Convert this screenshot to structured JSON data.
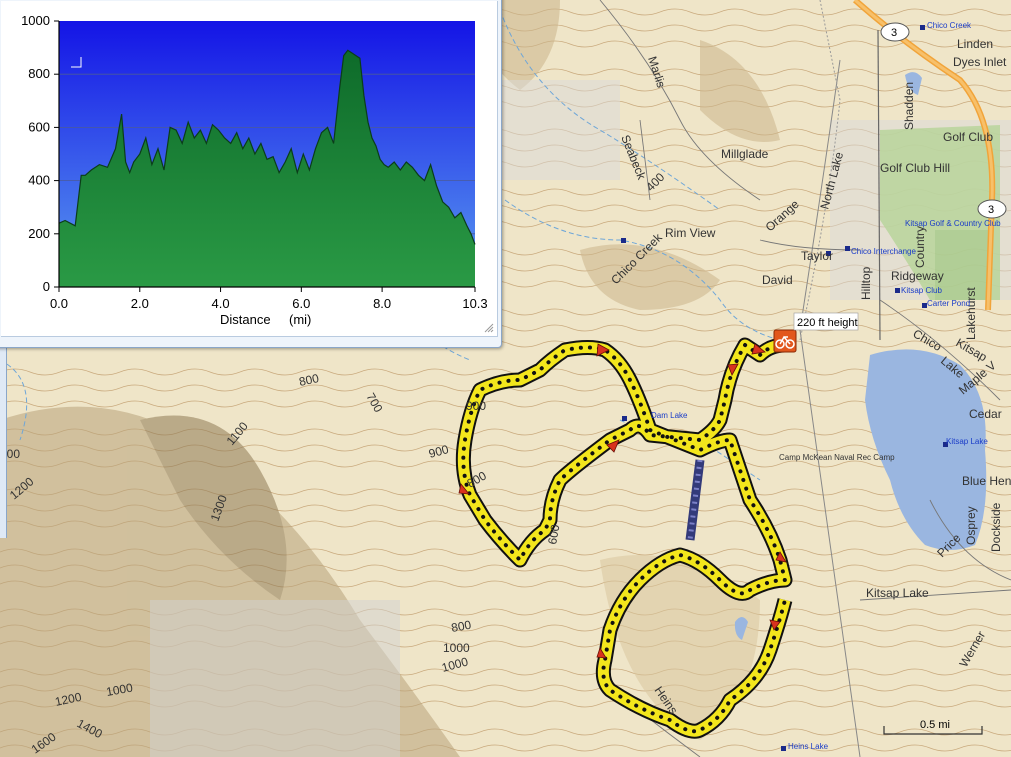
{
  "map": {
    "height_label": "220 ft height",
    "scale_label": "0.5 mi",
    "roads": [
      "Marlis",
      "Seabeck",
      "Millglade",
      "North Lake",
      "Orange",
      "Rim View",
      "Chico Creek",
      "Taylor",
      "David",
      "Hilltop",
      "Shadden",
      "Golf Club Hill",
      "Country",
      "Ridgeway",
      "Lakehurst",
      "Chico",
      "Lake",
      "Kitsap",
      "Maple V",
      "Cedar",
      "Blue Hen",
      "Osprey",
      "Dockside",
      "Price",
      "Kitsap Lake",
      "Werner",
      "Heins"
    ],
    "road_refs": [
      "3",
      "3"
    ],
    "places": [
      "Linden",
      "Dyes Inlet",
      "Golf Club"
    ],
    "pois": [
      "Chico Creek",
      "Chico Interchange",
      "Kitsap Golf & Country Club",
      "Kitsap Club",
      "Carter Pond",
      "Kitsap Lake",
      "Heins Lake",
      "Camp McKean Naval Rec Camp",
      "Dam Lake"
    ],
    "contours": [
      "400",
      "800",
      "700",
      "1100",
      "1200",
      "900",
      "800",
      "1300",
      "600",
      "900",
      "800",
      "1000",
      "1000",
      "1000",
      "1200",
      "1400",
      "1600",
      "400"
    ],
    "icons": {
      "cycling": "bicycle-icon",
      "waypoint": "arrow-marker-icon"
    }
  },
  "chart_data": {
    "type": "area",
    "xlabel": "Distance",
    "xunit": "(mi)",
    "ylabel": "",
    "xlim": [
      0,
      10.3
    ],
    "ylim": [
      0,
      1000
    ],
    "xticks": [
      "0.0",
      "2.0",
      "4.0",
      "6.0",
      "8.0",
      "10.3"
    ],
    "yticks": [
      "0",
      "200",
      "400",
      "600",
      "800",
      "1000"
    ],
    "grid": true,
    "colors": {
      "sky_top": "#1414e6",
      "sky_bottom": "#5a9cf0",
      "fill": "#2a9a45",
      "fill_dark": "#0e6b2a"
    },
    "x": [
      0.0,
      0.15,
      0.4,
      0.55,
      0.65,
      0.8,
      1.0,
      1.2,
      1.4,
      1.55,
      1.65,
      1.75,
      1.85,
      2.0,
      2.15,
      2.3,
      2.45,
      2.6,
      2.75,
      2.9,
      3.05,
      3.2,
      3.35,
      3.5,
      3.65,
      3.8,
      3.95,
      4.1,
      4.25,
      4.4,
      4.55,
      4.7,
      4.85,
      5.0,
      5.15,
      5.3,
      5.45,
      5.6,
      5.75,
      5.9,
      6.05,
      6.2,
      6.35,
      6.5,
      6.65,
      6.8,
      6.95,
      7.05,
      7.15,
      7.25,
      7.35,
      7.45,
      7.55,
      7.65,
      7.75,
      7.85,
      7.95,
      8.05,
      8.15,
      8.3,
      8.45,
      8.6,
      8.75,
      8.9,
      9.05,
      9.2,
      9.35,
      9.5,
      9.65,
      9.8,
      9.95,
      10.1,
      10.2,
      10.3
    ],
    "y": [
      240,
      250,
      230,
      420,
      420,
      440,
      460,
      450,
      520,
      650,
      470,
      430,
      470,
      500,
      560,
      460,
      520,
      440,
      600,
      590,
      540,
      620,
      560,
      590,
      540,
      610,
      590,
      560,
      540,
      580,
      520,
      560,
      500,
      540,
      480,
      490,
      430,
      470,
      520,
      430,
      500,
      440,
      520,
      580,
      600,
      540,
      750,
      870,
      890,
      880,
      870,
      860,
      720,
      620,
      560,
      530,
      480,
      460,
      450,
      470,
      440,
      470,
      450,
      420,
      400,
      460,
      380,
      320,
      300,
      260,
      280,
      230,
      200,
      160
    ]
  }
}
